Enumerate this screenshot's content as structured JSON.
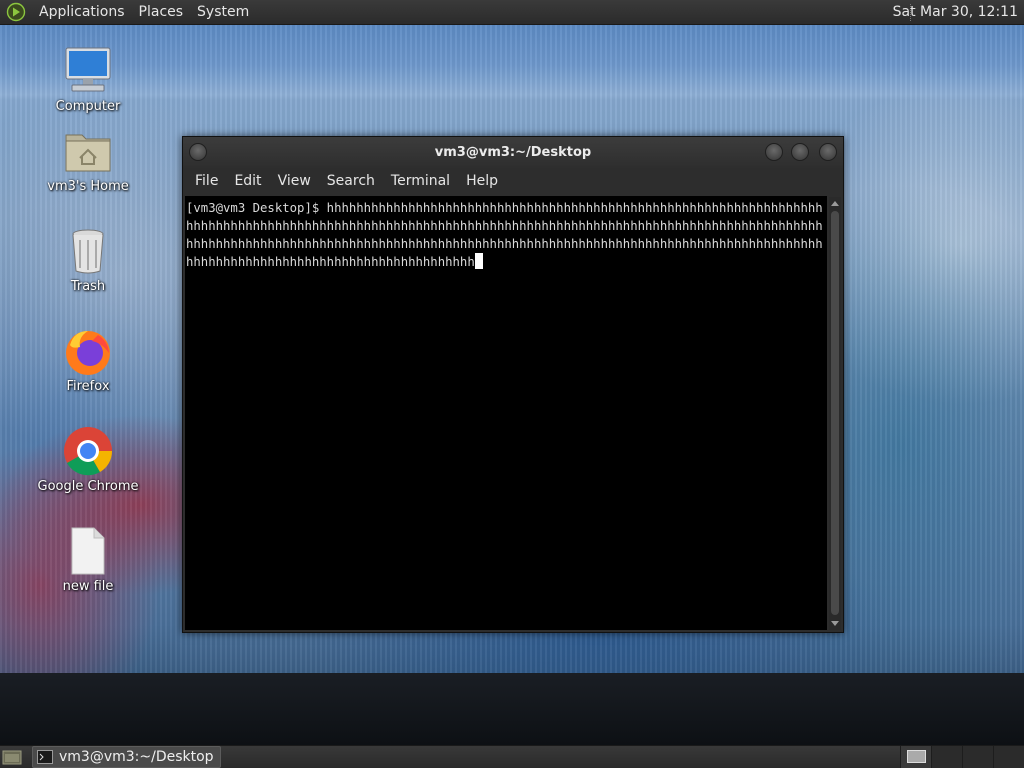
{
  "top_panel": {
    "menus": [
      "Applications",
      "Places",
      "System"
    ],
    "clock": "Sat Mar 30, 12:11"
  },
  "desktop": {
    "icons": [
      {
        "label": "Computer",
        "icon": "computer-icon"
      },
      {
        "label": "vm3's Home",
        "icon": "home-folder-icon"
      },
      {
        "label": "Trash",
        "icon": "trash-icon"
      },
      {
        "label": "Firefox",
        "icon": "firefox-icon"
      },
      {
        "label": "Google Chrome",
        "icon": "chrome-icon"
      },
      {
        "label": "new file",
        "icon": "file-icon"
      }
    ]
  },
  "terminal": {
    "title": "vm3@vm3:~/Desktop",
    "menus": [
      "File",
      "Edit",
      "View",
      "Search",
      "Terminal",
      "Help"
    ],
    "text": "[vm3@vm3 Desktop]$ hhhhhhhhhhhhhhhhhhhhhhhhhhhhhhhhhhhhhhhhhhhhhhhhhhhhhhhhhhhhhhhhhhhhhhhhhhhhhhhhhhhhhhhhhhhhhhhhhhhhhhhhhhhhhhhhhhhhhhhhhhhhhhhhhhhhhhhhhhhhhhhhhhhhhhhhhhhhhhhhhhhhhhhhhhhhhhhhhhhhhhhhhhhhhhhhhhhhhhhhhhhhhhhhhhhhhhhhhhhhhhhhhhhhhhhhhhhhhhhhhhhhhhhhhhhhhhhhhhhhhhhhhhhhhhhhhhhhhh"
  },
  "bottom_panel": {
    "task_label": "vm3@vm3:~/Desktop"
  },
  "colors": {
    "terminal_bg": "#000000",
    "panel_bg": "#2b2b2b",
    "text": "#e6e6e6"
  }
}
